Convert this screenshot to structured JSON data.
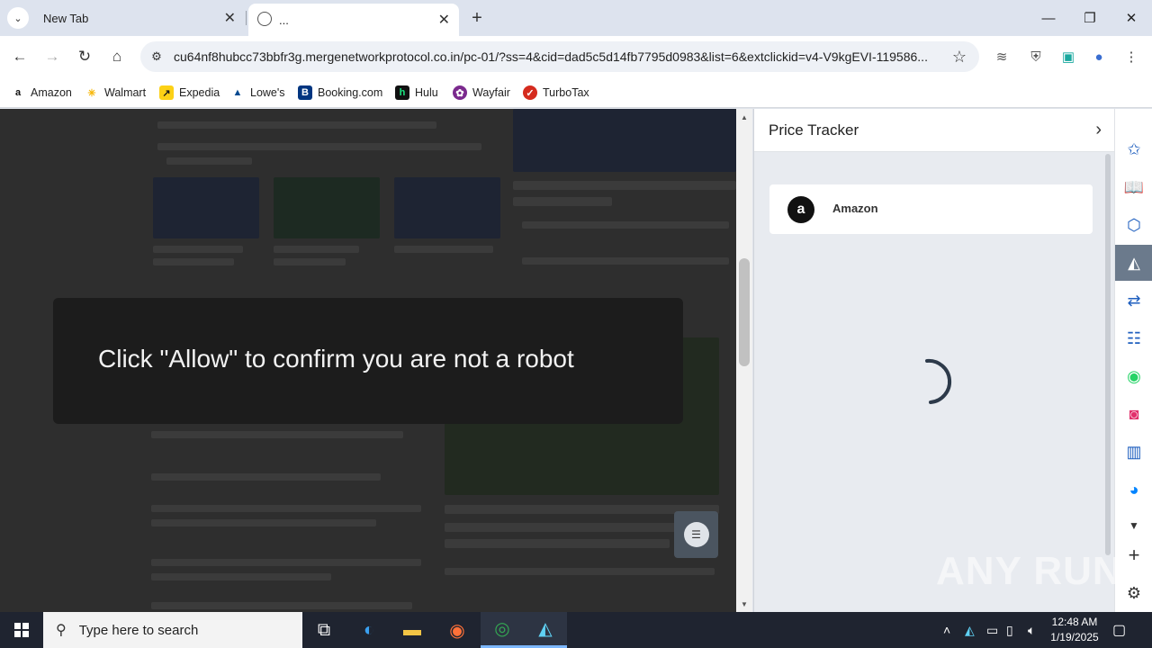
{
  "tabs": [
    {
      "label": "New Tab"
    },
    {
      "label": "..."
    }
  ],
  "address_bar": {
    "url": "cu64nf8hubcc73bbfr3g.mergenetworkprotocol.co.in/pc-01/?ss=4&cid=dad5c5d14fb7795d0983&list=6&extclickid=v4-V9kgEVI-119586..."
  },
  "bookmarks": [
    {
      "label": "Amazon",
      "color": "#111111",
      "glyph": "a"
    },
    {
      "label": "Walmart",
      "color": "#f7b500",
      "glyph": "✳"
    },
    {
      "label": "Expedia",
      "color": "#fcd116",
      "glyph": "↗"
    },
    {
      "label": "Lowe's",
      "color": "#004990",
      "glyph": "▲"
    },
    {
      "label": "Booking.com",
      "color": "#003580",
      "glyph": "B"
    },
    {
      "label": "Hulu",
      "color": "#111111",
      "glyph": "h"
    },
    {
      "label": "Wayfair",
      "color": "#7b2a8e",
      "glyph": "✿"
    },
    {
      "label": "TurboTax",
      "color": "#d52b1e",
      "glyph": "✓"
    }
  ],
  "page": {
    "overlay_message": "Click \"Allow\" to confirm you are not a robot"
  },
  "side_panel": {
    "title": "Price Tracker",
    "store_name": "Amazon",
    "store_glyph": "a"
  },
  "watermark": "ANY RUN",
  "taskbar": {
    "search_placeholder": "Type here to search",
    "time": "12:48 AM",
    "date": "1/19/2025"
  }
}
